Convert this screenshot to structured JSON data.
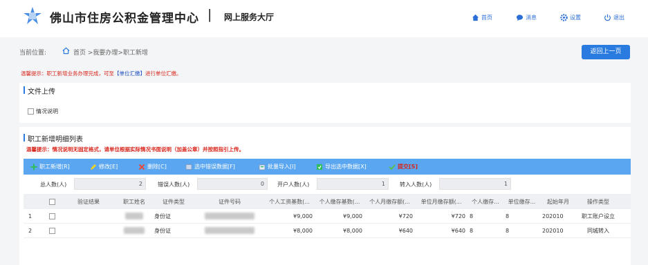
{
  "header": {
    "title": "佛山市住房公积金管理中心",
    "separator": "|",
    "subtitle": "网上服务大厅",
    "nav": {
      "home": "首页",
      "messages": "消息",
      "settings": "设置",
      "logout": "退出"
    }
  },
  "breadcrumb": {
    "label": "当前位置:",
    "path": "首页 >我要办理>职工新增"
  },
  "back_button": "返回上一页",
  "tip_top": {
    "before": "温馨提示：职工新增业务办理完成，可至",
    "link": "【单位汇缴】",
    "after": "进行单位汇缴。"
  },
  "upload_section": {
    "title": "文件上传",
    "checkbox_label": "情况说明"
  },
  "list_section": {
    "title": "职工新增明细列表",
    "tip": "温馨提示：情况说明无固定格式，请单位根据实际情况书面说明（加盖公章）并按照指引上传。"
  },
  "toolbar": {
    "add": "职工新增[R]",
    "edit": "修改[E]",
    "delete": "删除[C]",
    "check_errors": "选中错误数据[F]",
    "batch_import": "批量导入[I]",
    "export": "导出选中数据[X]",
    "submit": "提交[S]"
  },
  "stats": {
    "total_label": "总人数(人)",
    "total_value": "2",
    "error_label": "错误人数(人)",
    "error_value": "0",
    "open_label": "开户人数(人)",
    "open_value": "1",
    "transfer_label": "转入人数(人)",
    "transfer_value": "1"
  },
  "table": {
    "columns": [
      "验证结果",
      "职工姓名",
      "证件类型",
      "证件号码",
      "个人工资基数(...",
      "个人缴存基数(...",
      "个人月缴存额(...",
      "单位月缴存额(...",
      "个人缴存...",
      "单位缴存...",
      "起始年月",
      "操作类型"
    ],
    "rows": [
      {
        "no": "1",
        "verify": "",
        "id_type": "身份证",
        "salary_base": "¥9,000",
        "deposit_base": "¥9,000",
        "personal_monthly": "¥720",
        "unit_monthly": "¥720",
        "personal_rate": "8",
        "unit_rate": "8",
        "start": "202010",
        "op": "职工账户设立"
      },
      {
        "no": "2",
        "verify": "",
        "id_type": "身份证",
        "salary_base": "¥8,000",
        "deposit_base": "¥8,000",
        "personal_monthly": "¥640",
        "unit_monthly": "¥640",
        "personal_rate": "8",
        "unit_rate": "8",
        "start": "202010",
        "op": "同城转入"
      }
    ]
  },
  "colors": {
    "accent": "#2a7be0",
    "toolbar": "#5aa6f0",
    "warning": "#d9261c"
  },
  "icons": [
    "logo-icon",
    "home-icon",
    "message-icon",
    "gear-icon",
    "power-icon",
    "add-icon",
    "edit-icon",
    "delete-icon",
    "error-icon",
    "import-icon",
    "export-icon",
    "check-icon"
  ]
}
